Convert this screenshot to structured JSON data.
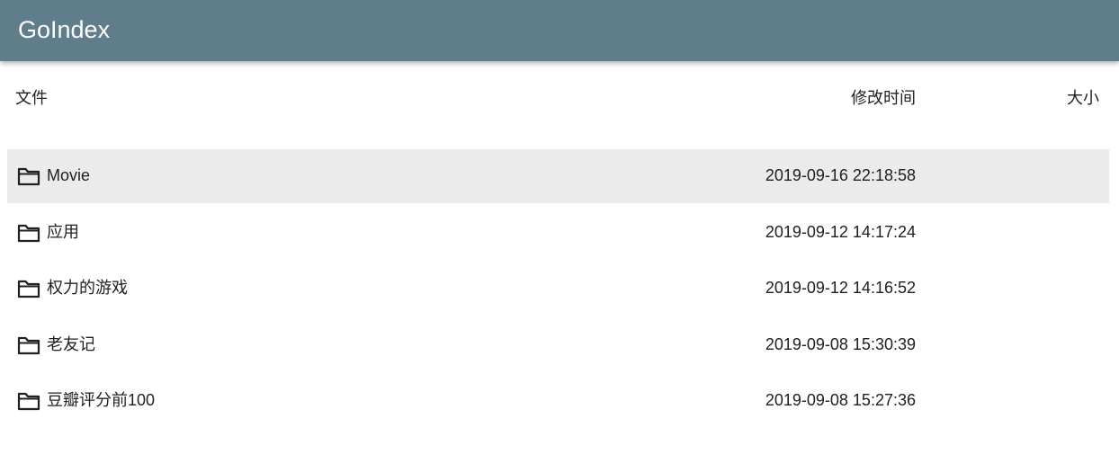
{
  "app": {
    "title": "GoIndex"
  },
  "header": {
    "col_file": "文件",
    "col_modified": "修改时间",
    "col_size": "大小"
  },
  "files": [
    {
      "name": "Movie",
      "modified": "2019-09-16 22:18:58",
      "size": "",
      "icon": "folder-icon",
      "selected": true
    },
    {
      "name": "应用",
      "modified": "2019-09-12 14:17:24",
      "size": "",
      "icon": "folder-icon",
      "selected": false
    },
    {
      "name": "权力的游戏",
      "modified": "2019-09-12 14:16:52",
      "size": "",
      "icon": "folder-icon",
      "selected": false
    },
    {
      "name": "老友记",
      "modified": "2019-09-08 15:30:39",
      "size": "",
      "icon": "folder-icon",
      "selected": false
    },
    {
      "name": "豆瓣评分前100",
      "modified": "2019-09-08 15:27:36",
      "size": "",
      "icon": "folder-icon",
      "selected": false
    }
  ],
  "colors": {
    "appbar": "#607d8b",
    "selected_row": "#ebebeb",
    "text": "#212121"
  }
}
